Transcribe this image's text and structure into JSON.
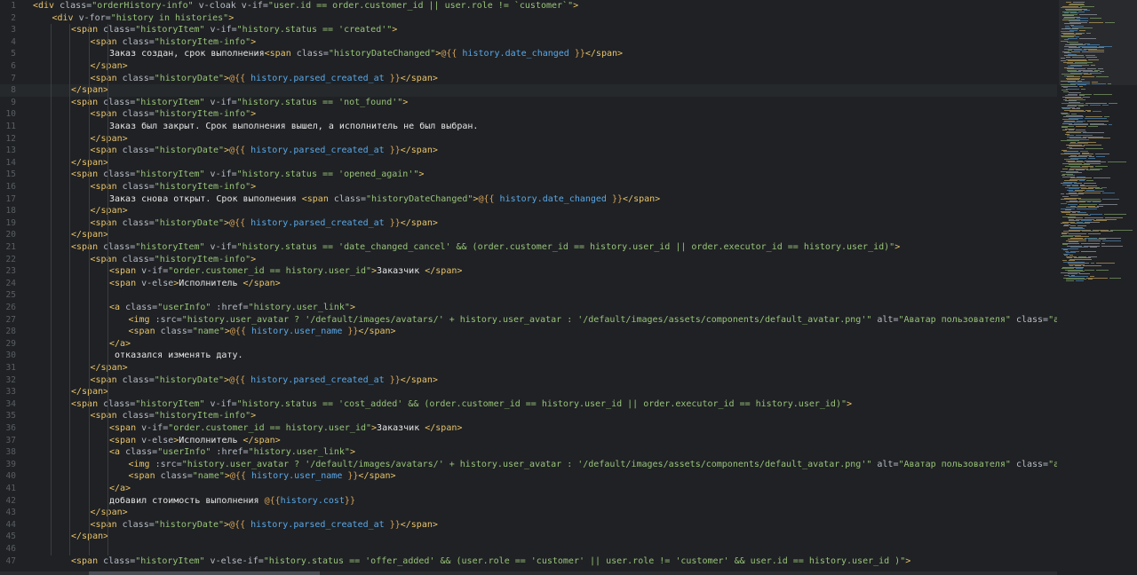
{
  "editor": {
    "current_line": 8,
    "lines": [
      {
        "n": 1,
        "indent": 0,
        "tokens": [
          [
            "tag",
            "<div "
          ],
          [
            "attr",
            "class="
          ],
          [
            "str",
            "\"orderHistory-info\""
          ],
          [
            "attr",
            " v-cloak v-if="
          ],
          [
            "str",
            "\"user.id == order.customer_id || user.role != `customer`\""
          ],
          [
            "tag",
            ">"
          ]
        ]
      },
      {
        "n": 2,
        "indent": 1,
        "tokens": [
          [
            "tag",
            "<div "
          ],
          [
            "attr",
            "v-for="
          ],
          [
            "str",
            "\"history in histories\""
          ],
          [
            "tag",
            ">"
          ]
        ]
      },
      {
        "n": 3,
        "indent": 2,
        "tokens": [
          [
            "tag",
            "<span "
          ],
          [
            "attr",
            "class="
          ],
          [
            "str",
            "\"historyItem\""
          ],
          [
            "attr",
            " v-if="
          ],
          [
            "str",
            "\"history.status == 'created'\""
          ],
          [
            "tag",
            ">"
          ]
        ]
      },
      {
        "n": 4,
        "indent": 3,
        "tokens": [
          [
            "tag",
            "<span "
          ],
          [
            "attr",
            "class="
          ],
          [
            "str",
            "\"historyItem-info\""
          ],
          [
            "tag",
            ">"
          ]
        ]
      },
      {
        "n": 5,
        "indent": 4,
        "tokens": [
          [
            "txt",
            "Заказ создан, срок выполнения"
          ],
          [
            "tag",
            "<span "
          ],
          [
            "attr",
            "class="
          ],
          [
            "str",
            "\"historyDateChanged\""
          ],
          [
            "tag",
            ">"
          ],
          [
            "mus",
            "@{{ "
          ],
          [
            "var",
            "history.date_changed"
          ],
          [
            "mus",
            " }}"
          ],
          [
            "tag",
            "</span>"
          ]
        ]
      },
      {
        "n": 6,
        "indent": 3,
        "tokens": [
          [
            "tag",
            "</span>"
          ]
        ]
      },
      {
        "n": 7,
        "indent": 3,
        "tokens": [
          [
            "tag",
            "<span "
          ],
          [
            "attr",
            "class="
          ],
          [
            "str",
            "\"historyDate\""
          ],
          [
            "tag",
            ">"
          ],
          [
            "mus",
            "@{{ "
          ],
          [
            "var",
            "history.parsed_created_at"
          ],
          [
            "mus",
            " }}"
          ],
          [
            "tag",
            "</span>"
          ]
        ]
      },
      {
        "n": 8,
        "indent": 2,
        "tokens": [
          [
            "tag",
            "</span>"
          ]
        ]
      },
      {
        "n": 9,
        "indent": 2,
        "tokens": [
          [
            "tag",
            "<span "
          ],
          [
            "attr",
            "class="
          ],
          [
            "str",
            "\"historyItem\""
          ],
          [
            "attr",
            " v-if="
          ],
          [
            "str",
            "\"history.status == 'not_found'\""
          ],
          [
            "tag",
            ">"
          ]
        ]
      },
      {
        "n": 10,
        "indent": 3,
        "tokens": [
          [
            "tag",
            "<span "
          ],
          [
            "attr",
            "class="
          ],
          [
            "str",
            "\"historyItem-info\""
          ],
          [
            "tag",
            ">"
          ]
        ]
      },
      {
        "n": 11,
        "indent": 4,
        "tokens": [
          [
            "txt",
            "Заказ был закрыт. Срок выполнения вышел, а исполнитель не был выбран."
          ]
        ]
      },
      {
        "n": 12,
        "indent": 3,
        "tokens": [
          [
            "tag",
            "</span>"
          ]
        ]
      },
      {
        "n": 13,
        "indent": 3,
        "tokens": [
          [
            "tag",
            "<span "
          ],
          [
            "attr",
            "class="
          ],
          [
            "str",
            "\"historyDate\""
          ],
          [
            "tag",
            ">"
          ],
          [
            "mus",
            "@{{ "
          ],
          [
            "var",
            "history.parsed_created_at"
          ],
          [
            "mus",
            " }}"
          ],
          [
            "tag",
            "</span>"
          ]
        ]
      },
      {
        "n": 14,
        "indent": 2,
        "tokens": [
          [
            "tag",
            "</span>"
          ]
        ]
      },
      {
        "n": 15,
        "indent": 2,
        "tokens": [
          [
            "tag",
            "<span "
          ],
          [
            "attr",
            "class="
          ],
          [
            "str",
            "\"historyItem\""
          ],
          [
            "attr",
            " v-if="
          ],
          [
            "str",
            "\"history.status == 'opened_again'\""
          ],
          [
            "tag",
            ">"
          ]
        ]
      },
      {
        "n": 16,
        "indent": 3,
        "tokens": [
          [
            "tag",
            "<span "
          ],
          [
            "attr",
            "class="
          ],
          [
            "str",
            "\"historyItem-info\""
          ],
          [
            "tag",
            ">"
          ]
        ]
      },
      {
        "n": 17,
        "indent": 4,
        "tokens": [
          [
            "txt",
            "Заказ снова открыт. Срок выполнения "
          ],
          [
            "tag",
            "<span "
          ],
          [
            "attr",
            "class="
          ],
          [
            "str",
            "\"historyDateChanged\""
          ],
          [
            "tag",
            ">"
          ],
          [
            "mus",
            "@{{ "
          ],
          [
            "var",
            "history.date_changed"
          ],
          [
            "mus",
            " }}"
          ],
          [
            "tag",
            "</span>"
          ]
        ]
      },
      {
        "n": 18,
        "indent": 3,
        "tokens": [
          [
            "tag",
            "</span>"
          ]
        ]
      },
      {
        "n": 19,
        "indent": 3,
        "tokens": [
          [
            "tag",
            "<span "
          ],
          [
            "attr",
            "class="
          ],
          [
            "str",
            "\"historyDate\""
          ],
          [
            "tag",
            ">"
          ],
          [
            "mus",
            "@{{ "
          ],
          [
            "var",
            "history.parsed_created_at"
          ],
          [
            "mus",
            " }}"
          ],
          [
            "tag",
            "</span>"
          ]
        ]
      },
      {
        "n": 20,
        "indent": 2,
        "tokens": [
          [
            "tag",
            "</span>"
          ]
        ]
      },
      {
        "n": 21,
        "indent": 2,
        "tokens": [
          [
            "tag",
            "<span "
          ],
          [
            "attr",
            "class="
          ],
          [
            "str",
            "\"historyItem\""
          ],
          [
            "attr",
            " v-if="
          ],
          [
            "str",
            "\"history.status == 'date_changed_cancel' && (order.customer_id == history.user_id || order.executor_id == history.user_id)\""
          ],
          [
            "tag",
            ">"
          ]
        ]
      },
      {
        "n": 22,
        "indent": 3,
        "tokens": [
          [
            "tag",
            "<span "
          ],
          [
            "attr",
            "class="
          ],
          [
            "str",
            "\"historyItem-info\""
          ],
          [
            "tag",
            ">"
          ]
        ]
      },
      {
        "n": 23,
        "indent": 4,
        "tokens": [
          [
            "tag",
            "<span "
          ],
          [
            "attr",
            "v-if="
          ],
          [
            "str",
            "\"order.customer_id == history.user_id\""
          ],
          [
            "tag",
            ">"
          ],
          [
            "txt",
            "Заказчик "
          ],
          [
            "tag",
            "</span>"
          ]
        ]
      },
      {
        "n": 24,
        "indent": 4,
        "tokens": [
          [
            "tag",
            "<span "
          ],
          [
            "attr",
            "v-else"
          ],
          [
            "tag",
            ">"
          ],
          [
            "txt",
            "Исполнитель "
          ],
          [
            "tag",
            "</span>"
          ]
        ]
      },
      {
        "n": 25,
        "indent": 4,
        "tokens": []
      },
      {
        "n": 26,
        "indent": 4,
        "tokens": [
          [
            "tag",
            "<a "
          ],
          [
            "attr",
            "class="
          ],
          [
            "str",
            "\"userInfo\""
          ],
          [
            "attr",
            " :href="
          ],
          [
            "str",
            "\"history.user_link\""
          ],
          [
            "tag",
            ">"
          ]
        ]
      },
      {
        "n": 27,
        "indent": 5,
        "tokens": [
          [
            "tag",
            "<img "
          ],
          [
            "attr",
            ":src="
          ],
          [
            "str",
            "\"history.user_avatar ? '/default/images/avatars/' + history.user_avatar : '/default/images/assets/components/default_avatar.png'\""
          ],
          [
            "attr",
            " alt="
          ],
          [
            "str",
            "\"Аватар пользователя\""
          ],
          [
            "attr",
            " class="
          ],
          [
            "str",
            "\"avatar\""
          ],
          [
            "tag",
            ">"
          ]
        ]
      },
      {
        "n": 28,
        "indent": 5,
        "tokens": [
          [
            "tag",
            "<span "
          ],
          [
            "attr",
            "class="
          ],
          [
            "str",
            "\"name\""
          ],
          [
            "tag",
            ">"
          ],
          [
            "mus",
            "@{{ "
          ],
          [
            "var",
            "history.user_name"
          ],
          [
            "mus",
            " }}"
          ],
          [
            "tag",
            "</span>"
          ]
        ]
      },
      {
        "n": 29,
        "indent": 4,
        "tokens": [
          [
            "tag",
            "</a>"
          ]
        ]
      },
      {
        "n": 30,
        "indent": 4,
        "tokens": [
          [
            "txt",
            " отказался изменять дату."
          ]
        ]
      },
      {
        "n": 31,
        "indent": 3,
        "tokens": [
          [
            "tag",
            "</span>"
          ]
        ]
      },
      {
        "n": 32,
        "indent": 3,
        "tokens": [
          [
            "tag",
            "<span "
          ],
          [
            "attr",
            "class="
          ],
          [
            "str",
            "\"historyDate\""
          ],
          [
            "tag",
            ">"
          ],
          [
            "mus",
            "@{{ "
          ],
          [
            "var",
            "history.parsed_created_at"
          ],
          [
            "mus",
            " }}"
          ],
          [
            "tag",
            "</span>"
          ]
        ]
      },
      {
        "n": 33,
        "indent": 2,
        "tokens": [
          [
            "tag",
            "</span>"
          ]
        ]
      },
      {
        "n": 34,
        "indent": 2,
        "tokens": [
          [
            "tag",
            "<span "
          ],
          [
            "attr",
            "class="
          ],
          [
            "str",
            "\"historyItem\""
          ],
          [
            "attr",
            " v-if="
          ],
          [
            "str",
            "\"history.status == 'cost_added' && (order.customer_id == history.user_id || order.executor_id == history.user_id)\""
          ],
          [
            "tag",
            ">"
          ]
        ]
      },
      {
        "n": 35,
        "indent": 3,
        "tokens": [
          [
            "tag",
            "<span "
          ],
          [
            "attr",
            "class="
          ],
          [
            "str",
            "\"historyItem-info\""
          ],
          [
            "tag",
            ">"
          ]
        ]
      },
      {
        "n": 36,
        "indent": 4,
        "tokens": [
          [
            "tag",
            "<span "
          ],
          [
            "attr",
            "v-if="
          ],
          [
            "str",
            "\"order.customer_id == history.user_id\""
          ],
          [
            "tag",
            ">"
          ],
          [
            "txt",
            "Заказчик "
          ],
          [
            "tag",
            "</span>"
          ]
        ]
      },
      {
        "n": 37,
        "indent": 4,
        "tokens": [
          [
            "tag",
            "<span "
          ],
          [
            "attr",
            "v-else"
          ],
          [
            "tag",
            ">"
          ],
          [
            "txt",
            "Исполнитель "
          ],
          [
            "tag",
            "</span>"
          ]
        ]
      },
      {
        "n": 38,
        "indent": 4,
        "tokens": [
          [
            "tag",
            "<a "
          ],
          [
            "attr",
            "class="
          ],
          [
            "str",
            "\"userInfo\""
          ],
          [
            "attr",
            " :href="
          ],
          [
            "str",
            "\"history.user_link\""
          ],
          [
            "tag",
            ">"
          ]
        ]
      },
      {
        "n": 39,
        "indent": 5,
        "tokens": [
          [
            "tag",
            "<img "
          ],
          [
            "attr",
            ":src="
          ],
          [
            "str",
            "\"history.user_avatar ? '/default/images/avatars/' + history.user_avatar : '/default/images/assets/components/default_avatar.png'\""
          ],
          [
            "attr",
            " alt="
          ],
          [
            "str",
            "\"Аватар пользователя\""
          ],
          [
            "attr",
            " class="
          ],
          [
            "str",
            "\"avatar\""
          ],
          [
            "tag",
            ">"
          ]
        ]
      },
      {
        "n": 40,
        "indent": 5,
        "tokens": [
          [
            "tag",
            "<span "
          ],
          [
            "attr",
            "class="
          ],
          [
            "str",
            "\"name\""
          ],
          [
            "tag",
            ">"
          ],
          [
            "mus",
            "@{{ "
          ],
          [
            "var",
            "history.user_name"
          ],
          [
            "mus",
            " }}"
          ],
          [
            "tag",
            "</span>"
          ]
        ]
      },
      {
        "n": 41,
        "indent": 4,
        "tokens": [
          [
            "tag",
            "</a>"
          ]
        ]
      },
      {
        "n": 42,
        "indent": 4,
        "tokens": [
          [
            "txt",
            "добавил стоимость выполнения "
          ],
          [
            "mus",
            "@{{"
          ],
          [
            "var",
            "history.cost"
          ],
          [
            "mus",
            "}}"
          ]
        ]
      },
      {
        "n": 43,
        "indent": 3,
        "tokens": [
          [
            "tag",
            "</span>"
          ]
        ]
      },
      {
        "n": 44,
        "indent": 3,
        "tokens": [
          [
            "tag",
            "<span "
          ],
          [
            "attr",
            "class="
          ],
          [
            "str",
            "\"historyDate\""
          ],
          [
            "tag",
            ">"
          ],
          [
            "mus",
            "@{{ "
          ],
          [
            "var",
            "history.parsed_created_at"
          ],
          [
            "mus",
            " }}"
          ],
          [
            "tag",
            "</span>"
          ]
        ]
      },
      {
        "n": 45,
        "indent": 2,
        "tokens": [
          [
            "tag",
            "</span>"
          ]
        ]
      },
      {
        "n": 46,
        "indent": 2,
        "tokens": []
      },
      {
        "n": 47,
        "indent": 2,
        "tokens": [
          [
            "tag",
            "<span "
          ],
          [
            "attr",
            "class="
          ],
          [
            "str",
            "\"historyItem\""
          ],
          [
            "attr",
            " v-else-if="
          ],
          [
            "str",
            "\"history.status == 'offer_added' && (user.role == 'customer' || user.role != 'customer' && user.id == history.user_id )\""
          ],
          [
            "tag",
            ">"
          ]
        ]
      }
    ]
  },
  "colors": {
    "background": "#1f2124",
    "current_line": "#26292c",
    "line_number": "#5a5e63",
    "tag": "#e8c36a",
    "attr": "#b8bdc7",
    "string": "#98c379",
    "text": "#e6e6e6",
    "mustache": "#d7a257",
    "variable": "#5aa8e8"
  }
}
